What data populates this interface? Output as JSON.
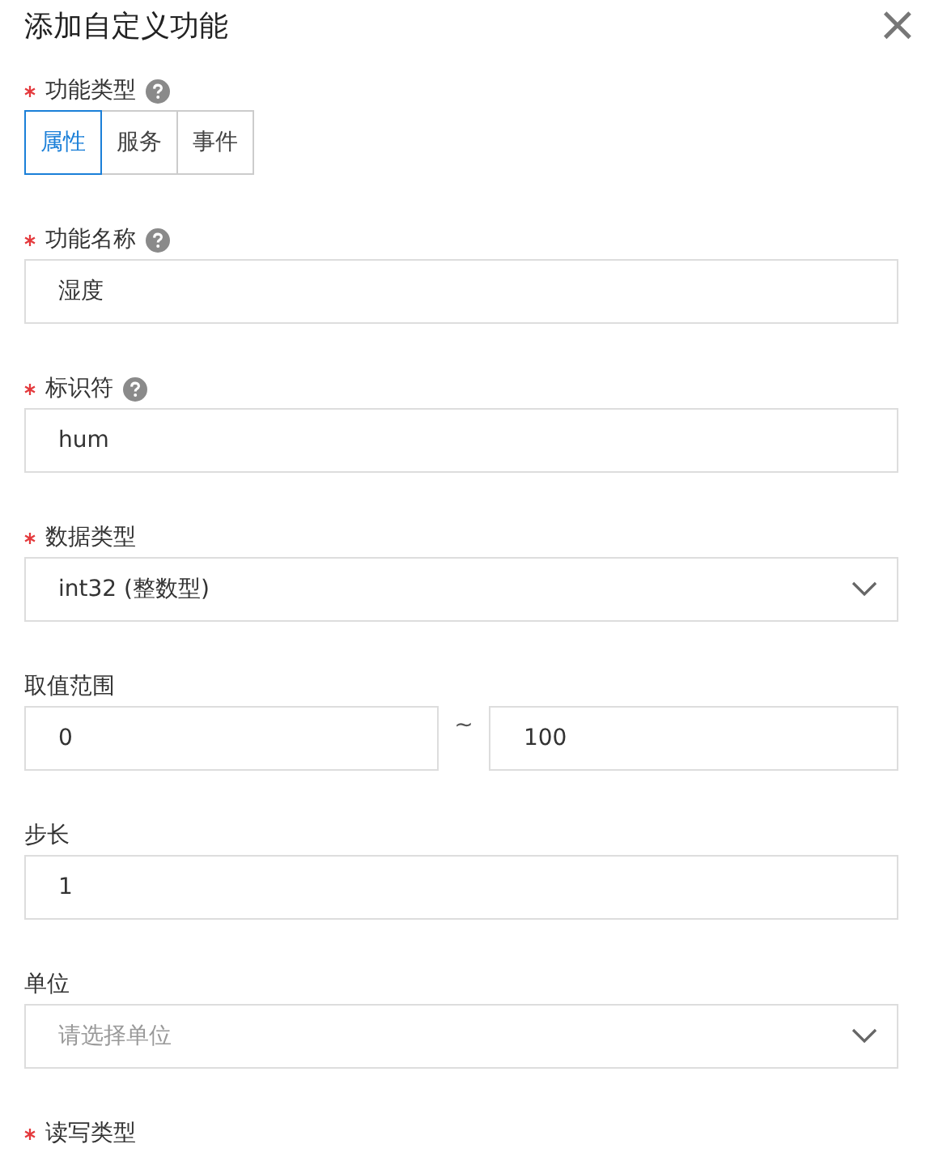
{
  "dialog": {
    "title": "添加自定义功能",
    "close": "×"
  },
  "fields": [
    {
      "kind": "segment",
      "label": "功能类型",
      "required": true,
      "help": true,
      "options": [
        {
          "label": "属性",
          "selected": true
        },
        {
          "label": "服务",
          "selected": false
        },
        {
          "label": "事件",
          "selected": false
        }
      ]
    },
    {
      "kind": "input",
      "label": "功能名称",
      "required": true,
      "help": true,
      "value": "湿度"
    },
    {
      "kind": "input",
      "label": "标识符",
      "required": true,
      "help": true,
      "value": "hum"
    },
    {
      "kind": "select",
      "label": "数据类型",
      "required": true,
      "help": false,
      "value": "int32 (整数型)"
    },
    {
      "kind": "range",
      "label": "取值范围",
      "required": false,
      "help": false,
      "min": "0",
      "separator": "~",
      "max": "100"
    },
    {
      "kind": "input",
      "label": "步长",
      "required": false,
      "help": false,
      "value": "1"
    },
    {
      "kind": "select",
      "label": "单位",
      "required": false,
      "help": false,
      "placeholder": "请选择单位"
    },
    {
      "kind": "label",
      "label": "读写类型",
      "required": true,
      "help": false
    }
  ]
}
